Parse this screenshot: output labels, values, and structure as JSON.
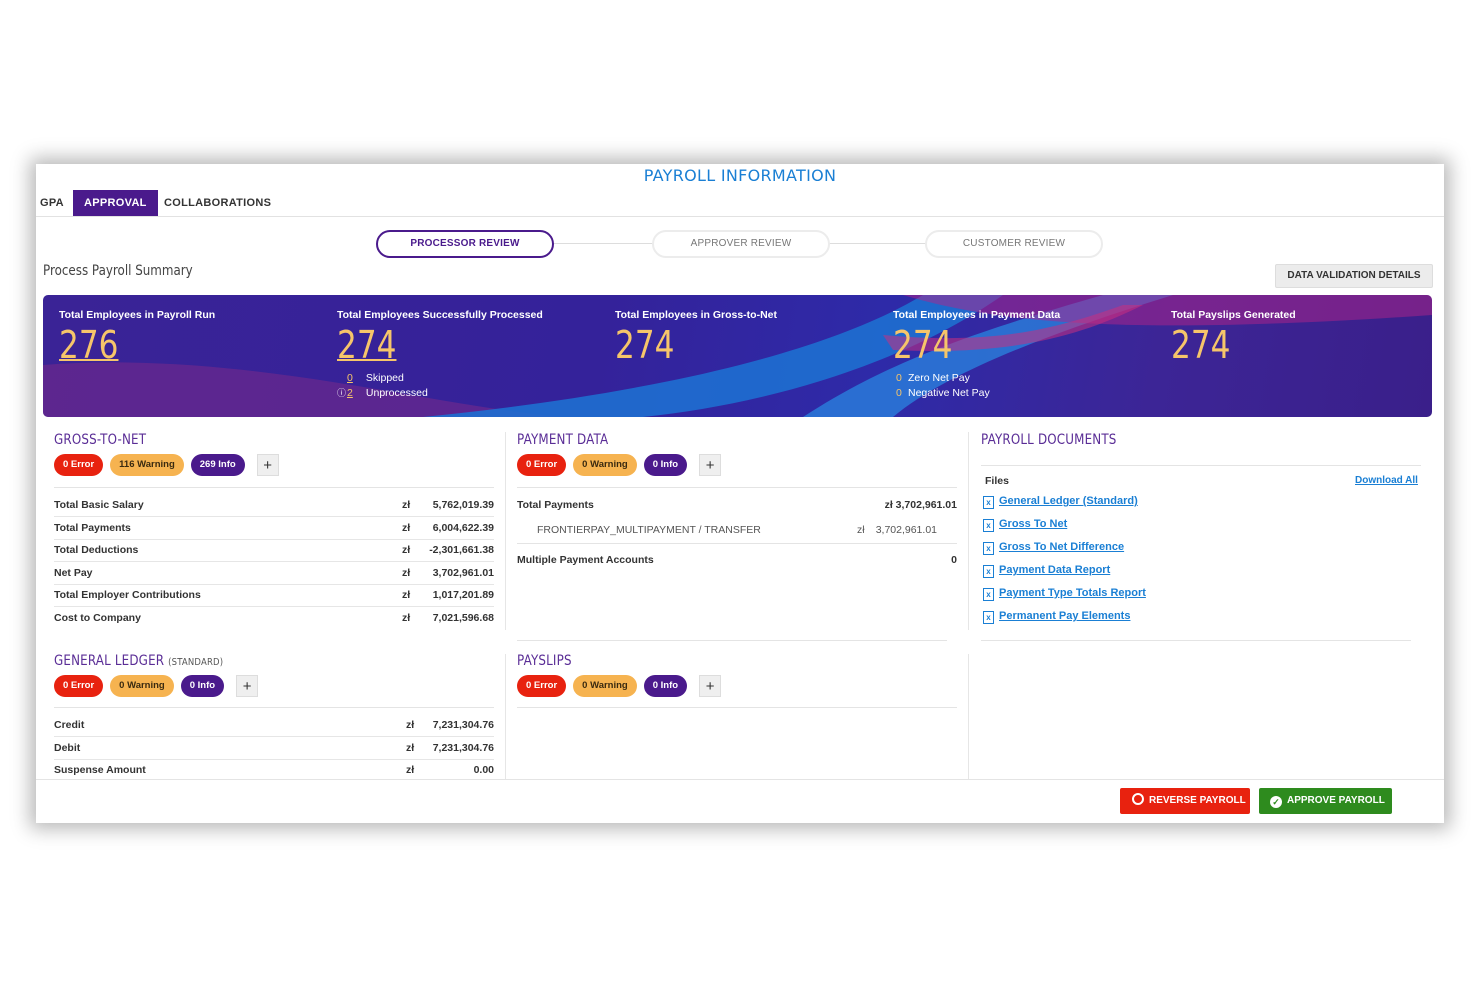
{
  "page_title": "PAYROLL INFORMATION",
  "tabs": [
    {
      "label": "GPA",
      "active": false
    },
    {
      "label": "APPROVAL",
      "active": true
    },
    {
      "label": "COLLABORATIONS",
      "active": false
    }
  ],
  "stepper": [
    {
      "label": "PROCESSOR REVIEW",
      "active": true
    },
    {
      "label": "APPROVER REVIEW",
      "active": false
    },
    {
      "label": "CUSTOMER REVIEW",
      "active": false
    }
  ],
  "summary_title": "Process Payroll Summary",
  "data_validation_button": "DATA VALIDATION DETAILS",
  "stats": [
    {
      "label": "Total Employees in Payroll Run",
      "value": "276"
    },
    {
      "label": "Total Employees Successfully Processed",
      "value": "274",
      "sub": [
        {
          "num": "0",
          "text": "Skipped"
        },
        {
          "num": "2",
          "text": "Unprocessed"
        }
      ]
    },
    {
      "label": "Total Employees in Gross-to-Net",
      "value": "274"
    },
    {
      "label": "Total Employees in Payment Data",
      "value": "274",
      "sub": [
        {
          "num": "0",
          "text": "Zero Net Pay"
        },
        {
          "num": "0",
          "text": "Negative Net Pay"
        }
      ]
    },
    {
      "label": "Total Payslips Generated",
      "value": "274"
    }
  ],
  "gross_to_net": {
    "title": "GROSS-TO-NET",
    "badges": {
      "error": "0 Error",
      "warning": "116 Warning",
      "info": "269 Info"
    },
    "currency": "zł",
    "rows": [
      {
        "label": "Total Basic Salary",
        "amount": "5,762,019.39"
      },
      {
        "label": "Total Payments",
        "amount": "6,004,622.39"
      },
      {
        "label": "Total Deductions",
        "amount": "-2,301,661.38"
      },
      {
        "label": "Net Pay",
        "amount": "3,702,961.01"
      },
      {
        "label": "Total Employer Contributions",
        "amount": "1,017,201.89"
      },
      {
        "label": "Cost to Company",
        "amount": "7,021,596.68"
      }
    ]
  },
  "payment_data": {
    "title": "PAYMENT DATA",
    "badges": {
      "error": "0 Error",
      "warning": "0 Warning",
      "info": "0 Info"
    },
    "total_payments_label": "Total Payments",
    "total_payments_value": "zł 3,702,961.01",
    "method_label": "FRONTIERPAY_MULTIPAYMENT / TRANSFER",
    "method_currency": "zł",
    "method_value": "3,702,961.01",
    "multiple_accounts_label": "Multiple Payment Accounts",
    "multiple_accounts_value": "0"
  },
  "payroll_documents": {
    "title": "PAYROLL DOCUMENTS",
    "files_label": "Files",
    "download_all": "Download All",
    "files": [
      "General Ledger (Standard)",
      "Gross To Net",
      "Gross To Net Difference",
      "Payment Data Report",
      "Payment Type Totals Report",
      "Permanent Pay Elements"
    ]
  },
  "general_ledger": {
    "title": "GENERAL LEDGER",
    "subtitle": "(STANDARD)",
    "badges": {
      "error": "0 Error",
      "warning": "0 Warning",
      "info": "0 Info"
    },
    "currency": "zł",
    "rows": [
      {
        "label": "Credit",
        "amount": "7,231,304.76"
      },
      {
        "label": "Debit",
        "amount": "7,231,304.76"
      },
      {
        "label": "Suspense Amount",
        "amount": "0.00"
      }
    ]
  },
  "payslips": {
    "title": "PAYSLIPS",
    "badges": {
      "error": "0 Error",
      "warning": "0 Warning",
      "info": "0 Info"
    }
  },
  "actions": {
    "reverse": "REVERSE PAYROLL",
    "approve": "APPROVE PAYROLL"
  },
  "colors": {
    "accent": "#4a1a8c",
    "link": "#1a7fd4",
    "error": "#e8220f",
    "warning": "#f6b350",
    "approve": "#2e8b1e",
    "stat_value": "#f6c56a"
  }
}
